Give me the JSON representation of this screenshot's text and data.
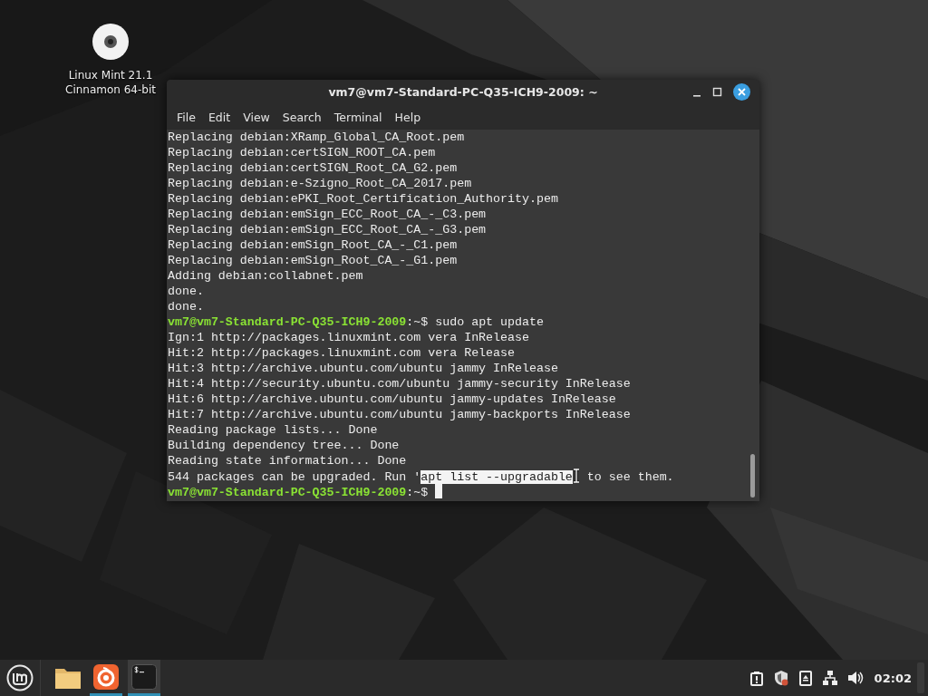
{
  "desktop_icons": [
    {
      "label_lines": [
        "Linux Mint 21.1",
        "Cinnamon 64-bit"
      ]
    }
  ],
  "window": {
    "title": "vm7@vm7-Standard-PC-Q35-ICH9-2009: ~",
    "focused": true,
    "menu": [
      "File",
      "Edit",
      "View",
      "Search",
      "Terminal",
      "Help"
    ],
    "lines": [
      {
        "kind": "output",
        "text": "Replacing debian:XRamp_Global_CA_Root.pem"
      },
      {
        "kind": "output",
        "text": "Replacing debian:certSIGN_ROOT_CA.pem"
      },
      {
        "kind": "output",
        "text": "Replacing debian:certSIGN_Root_CA_G2.pem"
      },
      {
        "kind": "output",
        "text": "Replacing debian:e-Szigno_Root_CA_2017.pem"
      },
      {
        "kind": "output",
        "text": "Replacing debian:ePKI_Root_Certification_Authority.pem"
      },
      {
        "kind": "output",
        "text": "Replacing debian:emSign_ECC_Root_CA_-_C3.pem"
      },
      {
        "kind": "output",
        "text": "Replacing debian:emSign_ECC_Root_CA_-_G3.pem"
      },
      {
        "kind": "output",
        "text": "Replacing debian:emSign_Root_CA_-_C1.pem"
      },
      {
        "kind": "output",
        "text": "Replacing debian:emSign_Root_CA_-_G1.pem"
      },
      {
        "kind": "output",
        "text": "Adding debian:collabnet.pem"
      },
      {
        "kind": "output",
        "text": "done."
      },
      {
        "kind": "output",
        "text": "done."
      },
      {
        "kind": "prompt",
        "host": "vm7@vm7-Standard-PC-Q35-ICH9-2009",
        "tail": ":~$",
        "command": "sudo apt update",
        "cursor": false
      },
      {
        "kind": "output",
        "text": "Ign:1 http://packages.linuxmint.com vera InRelease"
      },
      {
        "kind": "output",
        "text": "Hit:2 http://packages.linuxmint.com vera Release"
      },
      {
        "kind": "output",
        "text": "Hit:3 http://archive.ubuntu.com/ubuntu jammy InRelease"
      },
      {
        "kind": "output",
        "text": "Hit:4 http://security.ubuntu.com/ubuntu jammy-security InRelease"
      },
      {
        "kind": "output",
        "text": "Hit:6 http://archive.ubuntu.com/ubuntu jammy-updates InRelease"
      },
      {
        "kind": "output",
        "text": "Hit:7 http://archive.ubuntu.com/ubuntu jammy-backports InRelease"
      },
      {
        "kind": "output",
        "text": "Reading package lists... Done"
      },
      {
        "kind": "output",
        "text": "Building dependency tree... Done"
      },
      {
        "kind": "output",
        "text": "Reading state information... Done"
      },
      {
        "kind": "selection",
        "before": "544 packages can be upgraded. Run '",
        "selected": "apt list --upgradable",
        "after": " to see them."
      },
      {
        "kind": "prompt",
        "host": "vm7@vm7-Standard-PC-Q35-ICH9-2009",
        "tail": ":~$",
        "cursor": true
      }
    ]
  },
  "taskbar": {
    "apps": [
      {
        "kind": "folder",
        "running": false,
        "active": false
      },
      {
        "kind": "browser",
        "running": true,
        "active": false
      },
      {
        "kind": "terminal",
        "running": true,
        "active": true
      }
    ],
    "tray": [
      {
        "kind": "alert"
      },
      {
        "kind": "shield"
      },
      {
        "kind": "drive"
      },
      {
        "kind": "network"
      },
      {
        "kind": "volume"
      }
    ],
    "clock": "02:02"
  }
}
